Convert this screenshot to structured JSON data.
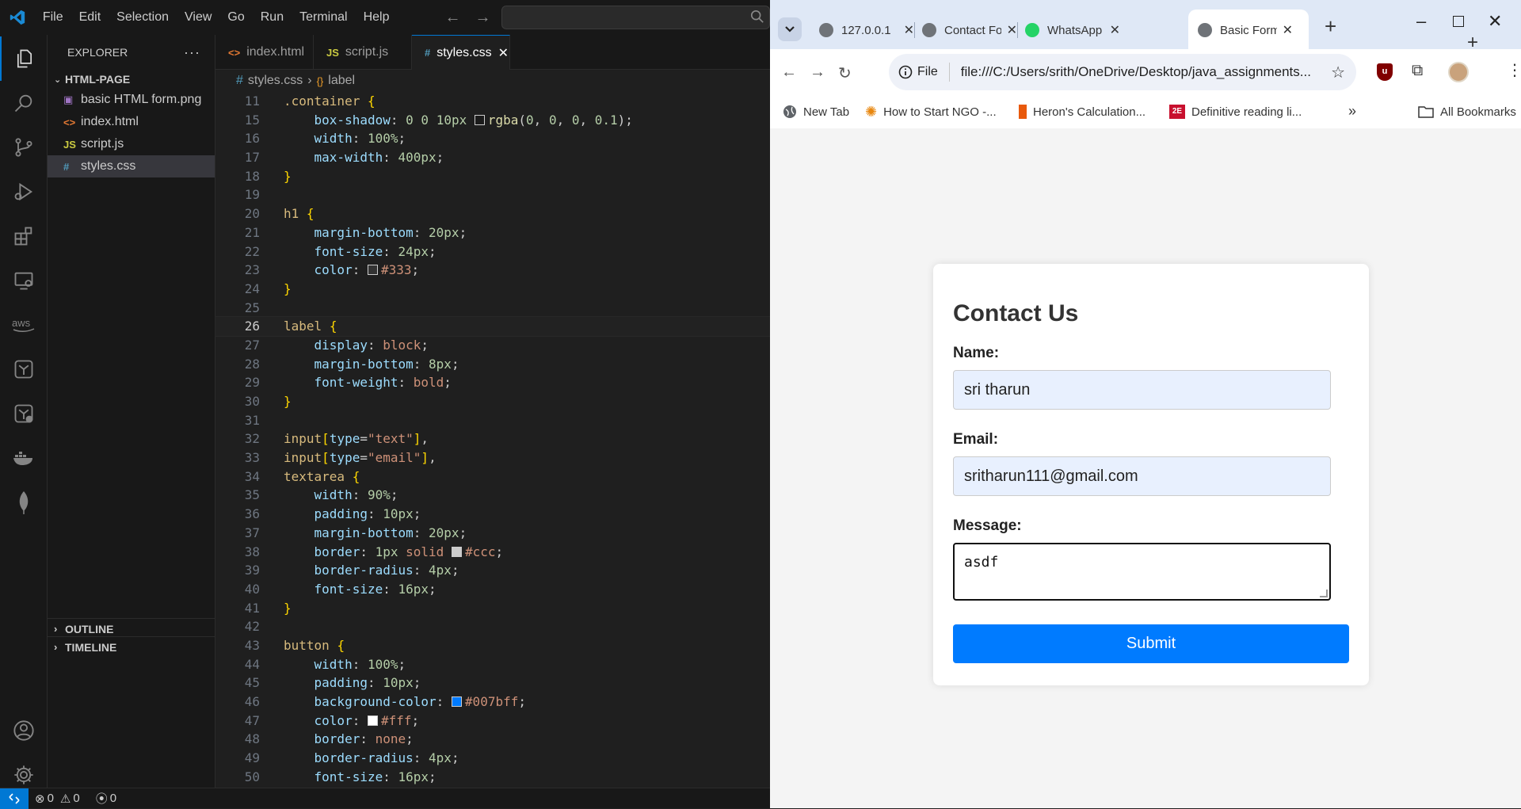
{
  "vscode": {
    "menu": [
      "File",
      "Edit",
      "Selection",
      "View",
      "Go",
      "Run",
      "Terminal",
      "Help"
    ],
    "explorer_title": "EXPLORER",
    "folder": "HTML-PAGE",
    "files": [
      {
        "name": "basic HTML form.png",
        "icon": "image-icon"
      },
      {
        "name": "index.html",
        "icon": "html-icon"
      },
      {
        "name": "script.js",
        "icon": "js-icon"
      },
      {
        "name": "styles.css",
        "icon": "css-icon",
        "selected": true
      }
    ],
    "outline": "OUTLINE",
    "timeline": "TIMELINE",
    "tabs": [
      {
        "label": "index.html",
        "icon": "<>"
      },
      {
        "label": "script.js",
        "icon": "JS"
      },
      {
        "label": "styles.css",
        "icon": "#",
        "active": true
      }
    ],
    "breadcrumb": {
      "file": "styles.css",
      "symbol": "label"
    },
    "status": {
      "errors": "0",
      "warnings": "0",
      "ports": "0"
    },
    "code_lines": [
      {
        "n": "11",
        "html": "<span class='sel'>.container</span> <span class='br'>{</span>"
      },
      {
        "n": "15",
        "html": "    <span class='prop'>box-shadow</span>: <span class='num'>0</span> <span class='num'>0</span> <span class='num'>10px</span> <span class='swatch' style='background:rgba(0,0,0,0.1)'></span><span class='fn'>rgba</span>(<span class='num'>0</span>, <span class='num'>0</span>, <span class='num'>0</span>, <span class='num'>0.1</span>);"
      },
      {
        "n": "16",
        "html": "    <span class='prop'>width</span>: <span class='num'>100%</span>;"
      },
      {
        "n": "17",
        "html": "    <span class='prop'>max-width</span>: <span class='num'>400px</span>;"
      },
      {
        "n": "18",
        "html": "<span class='br'>}</span>"
      },
      {
        "n": "19",
        "html": ""
      },
      {
        "n": "20",
        "html": "<span class='sel'>h1</span> <span class='br'>{</span>"
      },
      {
        "n": "21",
        "html": "    <span class='prop'>margin-bottom</span>: <span class='num'>20px</span>;"
      },
      {
        "n": "22",
        "html": "    <span class='prop'>font-size</span>: <span class='num'>24px</span>;"
      },
      {
        "n": "23",
        "html": "    <span class='prop'>color</span>: <span class='swatch' style='background:#333'></span><span class='val'>#333</span>;"
      },
      {
        "n": "24",
        "html": "<span class='br'>}</span>"
      },
      {
        "n": "25",
        "html": ""
      },
      {
        "n": "26",
        "html": "<span class='sel'>label</span> <span class='br'>{</span>",
        "current": true
      },
      {
        "n": "27",
        "html": "    <span class='prop'>display</span>: <span class='val'>block</span>;"
      },
      {
        "n": "28",
        "html": "    <span class='prop'>margin-bottom</span>: <span class='num'>8px</span>;"
      },
      {
        "n": "29",
        "html": "    <span class='prop'>font-weight</span>: <span class='val'>bold</span>;"
      },
      {
        "n": "30",
        "html": "<span class='br'>}</span>"
      },
      {
        "n": "31",
        "html": ""
      },
      {
        "n": "32",
        "html": "<span class='sel'>input</span><span class='br'>[</span><span class='prop'>type</span>=<span class='str'>\"text\"</span><span class='br'>]</span>,"
      },
      {
        "n": "33",
        "html": "<span class='sel'>input</span><span class='br'>[</span><span class='prop'>type</span>=<span class='str'>\"email\"</span><span class='br'>]</span>,"
      },
      {
        "n": "34",
        "html": "<span class='sel'>textarea</span> <span class='br'>{</span>"
      },
      {
        "n": "35",
        "html": "    <span class='prop'>width</span>: <span class='num'>90%</span>;"
      },
      {
        "n": "36",
        "html": "    <span class='prop'>padding</span>: <span class='num'>10px</span>;"
      },
      {
        "n": "37",
        "html": "    <span class='prop'>margin-bottom</span>: <span class='num'>20px</span>;"
      },
      {
        "n": "38",
        "html": "    <span class='prop'>border</span>: <span class='num'>1px</span> <span class='val'>solid</span> <span class='swatch' style='background:#ccc'></span><span class='val'>#ccc</span>;"
      },
      {
        "n": "39",
        "html": "    <span class='prop'>border-radius</span>: <span class='num'>4px</span>;"
      },
      {
        "n": "40",
        "html": "    <span class='prop'>font-size</span>: <span class='num'>16px</span>;"
      },
      {
        "n": "41",
        "html": "<span class='br'>}</span>"
      },
      {
        "n": "42",
        "html": ""
      },
      {
        "n": "43",
        "html": "<span class='sel'>button</span> <span class='br'>{</span>"
      },
      {
        "n": "44",
        "html": "    <span class='prop'>width</span>: <span class='num'>100%</span>;"
      },
      {
        "n": "45",
        "html": "    <span class='prop'>padding</span>: <span class='num'>10px</span>;"
      },
      {
        "n": "46",
        "html": "    <span class='prop'>background-color</span>: <span class='swatch' style='background:#007bff'></span><span class='val'>#007bff</span>;"
      },
      {
        "n": "47",
        "html": "    <span class='prop'>color</span>: <span class='swatch' style='background:#fff'></span><span class='val'>#fff</span>;"
      },
      {
        "n": "48",
        "html": "    <span class='prop'>border</span>: <span class='val'>none</span>;"
      },
      {
        "n": "49",
        "html": "    <span class='prop'>border-radius</span>: <span class='num'>4px</span>;"
      },
      {
        "n": "50",
        "html": "    <span class='prop'>font-size</span>: <span class='num'>16px</span>;"
      }
    ]
  },
  "browser": {
    "tabs": [
      {
        "label": "127.0.0.1",
        "icon": "globe-icon"
      },
      {
        "label": "Contact Fo",
        "icon": "globe-icon"
      },
      {
        "label": "WhatsApp",
        "icon": "whatsapp-icon"
      },
      {
        "label": "Basic Form",
        "icon": "globe-icon",
        "active": true
      }
    ],
    "omnibox": {
      "chip": "File",
      "url": "file:///C:/Users/srith/OneDrive/Desktop/java_assignments..."
    },
    "bookmarks": [
      "New Tab",
      "How to Start NGO -...",
      "Heron's Calculation...",
      "Definitive reading li..."
    ],
    "all_bookmarks": "All Bookmarks",
    "form": {
      "title": "Contact Us",
      "name_label": "Name:",
      "name_value": "sri tharun",
      "email_label": "Email:",
      "email_value": "sritharun111@gmail.com",
      "message_label": "Message:",
      "message_value": "asdf",
      "submit_label": "Submit"
    }
  }
}
